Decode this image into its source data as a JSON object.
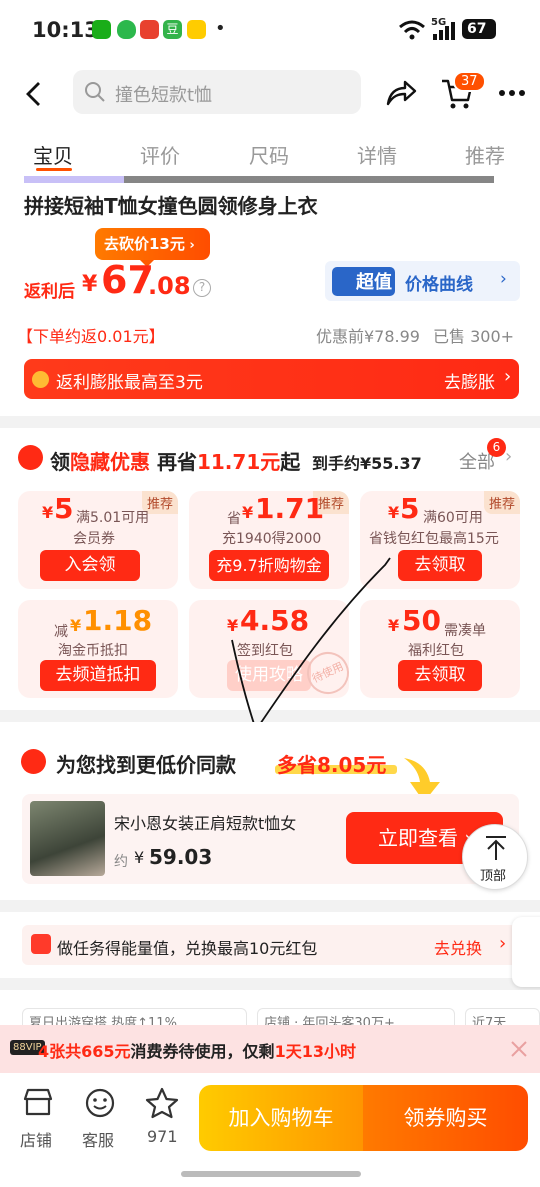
{
  "status": {
    "time": "10:13",
    "dot": "•",
    "network": "5G",
    "battery": "67"
  },
  "header": {
    "search_placeholder": "撞色短款t恤",
    "cart_count": "37"
  },
  "tabs": [
    "宝贝",
    "评价",
    "尺码",
    "详情",
    "推荐"
  ],
  "product": {
    "title_line1": "拼接短袖T恤女撞色圆领修身上衣",
    "bargain": "去砍价13元",
    "price_prefix": "返利后",
    "currency": "¥",
    "price_int": "67",
    "price_dec": ".08",
    "curve_badge": "超值",
    "curve_label": "价格曲线",
    "rebate": "【下单约返0.01元】",
    "orig_price": "优惠前¥78.99",
    "sold": "已售 300+",
    "rebate_bar": "返利膨胀最高至3元",
    "rebate_bar_cta": "去膨胀"
  },
  "coupons": {
    "title_a": "领",
    "title_b": "隐藏优惠",
    "title_c": "再省",
    "title_amount": "11.71元",
    "title_d": "起",
    "net": "到手约¥55.37",
    "all": "全部",
    "all_badge": "6",
    "items": [
      {
        "tag": "推荐",
        "cur": "¥",
        "amt": "5",
        "cond": "满5.01可用",
        "desc": "会员券",
        "btn": "入会领"
      },
      {
        "tag": "推荐",
        "pre": "省",
        "cur": "¥",
        "amt": "1.71",
        "cond": "",
        "desc": "充1940得2000",
        "btn": "充9.7折购物金"
      },
      {
        "tag": "推荐",
        "cur": "¥",
        "amt": "5",
        "cond": "满60可用",
        "desc": "省钱包红包最高15元",
        "btn": "去领取"
      },
      {
        "pre": "减",
        "cur": "¥",
        "amt": "1.18",
        "cond": "",
        "desc": "淘金币抵扣",
        "btn": "去频道抵扣"
      },
      {
        "cur": "¥",
        "amt": "4.58",
        "cond": "",
        "desc": "签到红包",
        "btn": "使用攻略",
        "stamp": "待使用"
      },
      {
        "cur": "¥",
        "amt": "50",
        "cond": "需凑单",
        "desc": "福利红包",
        "btn": "去领取"
      }
    ]
  },
  "cheaper": {
    "title": "为您找到更低价同款",
    "save": "多省8.05元",
    "item_name": "宋小恩女装正肩短款t恤女",
    "approx": "约",
    "currency": "¥",
    "price": "59.03",
    "btn": "立即查看",
    "top": "顶部"
  },
  "task": {
    "text": "做任务得能量值，兑换最高10元红包",
    "cta": "去兑换"
  },
  "pills": [
    "夏日出游穿搭 热度↑11%",
    "店铺 · 年回头客30万+",
    "近7天"
  ],
  "vip": {
    "badge": "88VIP",
    "count": "4张共665元",
    "mid": "消费券待使用，仅剩",
    "time": "1天13小时"
  },
  "bottom": {
    "shop": "店铺",
    "service": "客服",
    "fav": "971",
    "cart_btn": "加入购物车",
    "buy_btn": "领券购买"
  },
  "colors": {
    "red": "#ff2a14",
    "orange": "#ff9000",
    "blue": "#2a66c8"
  }
}
